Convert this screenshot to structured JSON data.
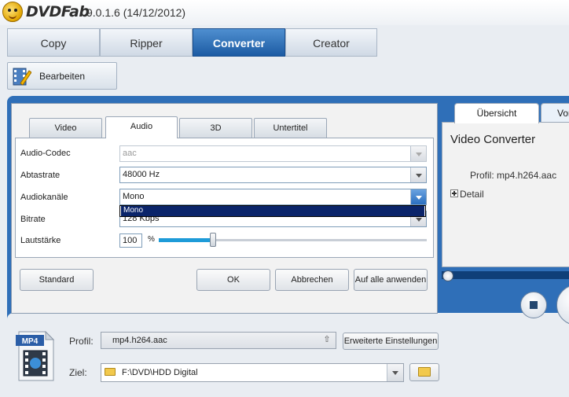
{
  "app": {
    "name": "DVDFab",
    "version": "9.0.1.6 (14/12/2012)"
  },
  "main_tabs": [
    {
      "label": "Copy",
      "active": false
    },
    {
      "label": "Ripper",
      "active": false
    },
    {
      "label": "Converter",
      "active": true
    },
    {
      "label": "Creator",
      "active": false
    }
  ],
  "toolbar": {
    "edit_label": "Bearbeiten"
  },
  "settings": {
    "tabs": [
      {
        "label": "Video",
        "active": false
      },
      {
        "label": "Audio",
        "active": true
      },
      {
        "label": "3D",
        "active": false
      },
      {
        "label": "Untertitel",
        "active": false
      }
    ],
    "fields": {
      "audio_codec": {
        "label": "Audio-Codec",
        "value": "aac",
        "disabled": true
      },
      "sample_rate": {
        "label": "Abtastrate",
        "value": "48000 Hz"
      },
      "channels": {
        "label": "Audiokanäle",
        "value": "Mono",
        "open": true,
        "options": [
          "Mono"
        ]
      },
      "bitrate": {
        "label": "Bitrate",
        "value": "128 Kbps"
      },
      "volume": {
        "label": "Lautstärke",
        "value": "100",
        "unit": "%",
        "slider_fraction": 0.2
      }
    },
    "buttons": {
      "standard": "Standard",
      "ok": "OK",
      "cancel": "Abbrechen",
      "apply_all": "Auf alle anwenden"
    }
  },
  "overview": {
    "tabs": [
      {
        "label": "Übersicht",
        "active": true
      },
      {
        "label": "Vor",
        "active": false
      }
    ],
    "title": "Video Converter",
    "profile": "Profil: mp4.h264.aac",
    "detail": "Detail"
  },
  "bottom": {
    "format_badge": "MP4",
    "profile_label": "Profil:",
    "profile_value": "mp4.h264.aac",
    "advanced_button": "Erweiterte Einstellungen",
    "target_label": "Ziel:",
    "target_value": "F:\\DVD\\HDD Digital"
  },
  "colors": {
    "accent_blue": "#2f6fb8",
    "active_tab": "#1c5ba3",
    "selection": "#0a246a",
    "slider": "#1e9bd8"
  }
}
